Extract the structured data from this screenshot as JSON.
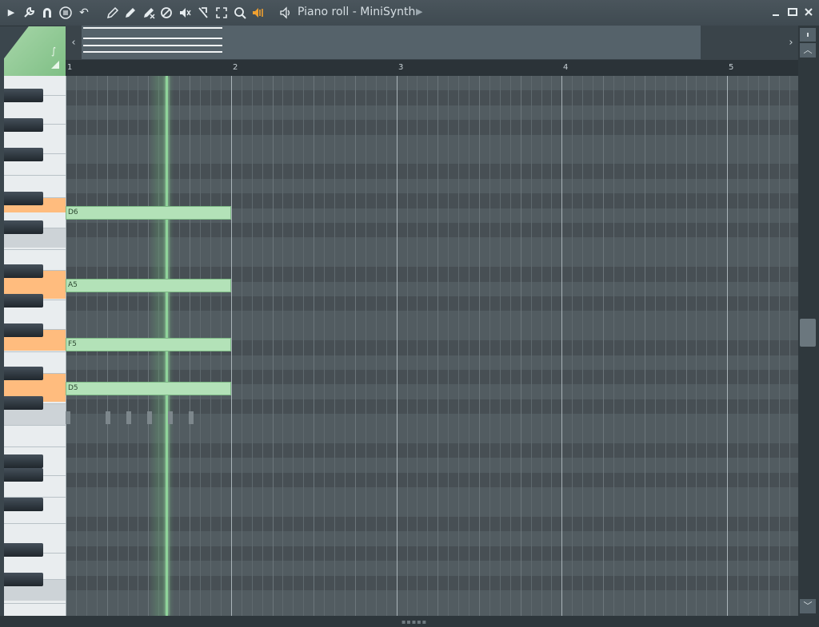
{
  "window": {
    "title": "Piano roll - MiniSynth",
    "minimize": "▁",
    "maximize": "□",
    "close": "✕"
  },
  "toolbar": {
    "items": [
      {
        "name": "menu-arrow-icon",
        "glyph": "▸"
      },
      {
        "name": "wrench-icon",
        "glyph": "🔧"
      },
      {
        "name": "magnet-icon",
        "glyph": "∩"
      },
      {
        "name": "list-icon",
        "glyph": "⊜"
      },
      {
        "name": "undo-icon",
        "glyph": "↶"
      },
      {
        "name": "pencil-icon",
        "glyph": "✎"
      },
      {
        "name": "paint-icon",
        "glyph": "✎"
      },
      {
        "name": "delete-icon",
        "glyph": "✗"
      },
      {
        "name": "mute-icon",
        "glyph": "⊘"
      },
      {
        "name": "speaker-mute-icon",
        "glyph": "◁"
      },
      {
        "name": "slice-icon",
        "glyph": "◪"
      },
      {
        "name": "select-icon",
        "glyph": "⛶"
      },
      {
        "name": "zoom-icon",
        "glyph": "⚲"
      },
      {
        "name": "playback-icon",
        "glyph": "◀"
      },
      {
        "name": "speaker-icon",
        "glyph": "◁"
      }
    ],
    "active_color": "#f0a030"
  },
  "ruler": {
    "bars": [
      "1",
      "2",
      "3",
      "4",
      "5"
    ]
  },
  "notes": [
    {
      "label": "D6"
    },
    {
      "label": "A5"
    },
    {
      "label": "F5"
    },
    {
      "label": "D5"
    }
  ],
  "scrollbar": {
    "up": "▲",
    "up2": "︿",
    "down": "﹀"
  },
  "overview": {
    "left": "‹",
    "right": "›"
  },
  "colors": {
    "note_fill": "#b3e2b8",
    "highlight_key": "#ffbc7e",
    "playhead": "#8fd39a"
  }
}
